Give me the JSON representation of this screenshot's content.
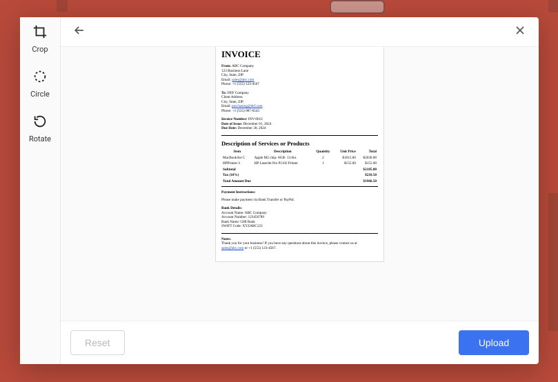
{
  "sidebar": {
    "tools": [
      {
        "label": "Crop"
      },
      {
        "label": "Circle"
      },
      {
        "label": "Rotate"
      }
    ]
  },
  "footer": {
    "reset_label": "Reset",
    "upload_label": "Upload"
  },
  "document": {
    "title": "INVOICE",
    "from_label": "From:",
    "from_name": "ABC Company",
    "from_addr1": "123 Business Lane",
    "from_addr2": "City, State, ZIP",
    "from_email_label": "Email:",
    "from_email": "sales@abc.com",
    "from_phone_label": "Phone:",
    "from_phone": "+1 (555) 123-4567",
    "to_label": "To:",
    "to_name": "DEF Company",
    "to_addr1": "Client Address",
    "to_addr2": "City, State, ZIP",
    "to_email_label": "Email:",
    "to_email": "purchasing@def.com",
    "to_phone_label": "Phone:",
    "to_phone": "+1 (555) 987-6543",
    "inv_num_label": "Invoice Number:",
    "inv_num": "INV-0012",
    "issue_label": "Date of Issue:",
    "issue_date": "December 01, 2024",
    "due_label": "Due Date:",
    "due_date": "December 30, 2024",
    "desc_heading": "Description of Services or Products",
    "col_item": "Item",
    "col_desc": "Description",
    "col_qty": "Quantity",
    "col_unit": "Unit Price",
    "col_total": "Total",
    "rows": [
      {
        "item": "MacBookAir-5",
        "desc": "Apple M2 chip- 8GB- 13.6in.",
        "qty": "2",
        "unit": "$1015.00",
        "total": "$2030.00"
      },
      {
        "item": "HPPrinter-3",
        "desc": "HP LaserJet Pro P1102 Printer",
        "qty": "1",
        "unit": "$155.00",
        "total": "$155.00"
      }
    ],
    "subtotal_label": "Subtotal",
    "subtotal": "$2185.00",
    "tax_label": "Tax (10%)",
    "tax": "$218.50",
    "total_due_label": "Total Amount Due",
    "total_due": "$1966.50",
    "payment_heading": "Payment Instructions:",
    "payment_text": "Please make payment via Bank Transfer or PayPal.",
    "bank_heading": "Bank Details:",
    "bank_acct_name_label": "Account Name:",
    "bank_acct_name": "ABC Company",
    "bank_acct_num_label": "Account Number:",
    "bank_acct_num": "123456789",
    "bank_name_label": "Bank Name:",
    "bank_name": "GHI Bank",
    "bank_swift_label": "SWIFT Code:",
    "bank_swift": "XYZABC123",
    "notes_heading": "Notes:",
    "notes_text_1": "Thank you for your business! If you have any questions about this invoice, please contact us at ",
    "notes_email": "sales@abc.com",
    "notes_text_2": " or +1 (555) 123-4567."
  }
}
